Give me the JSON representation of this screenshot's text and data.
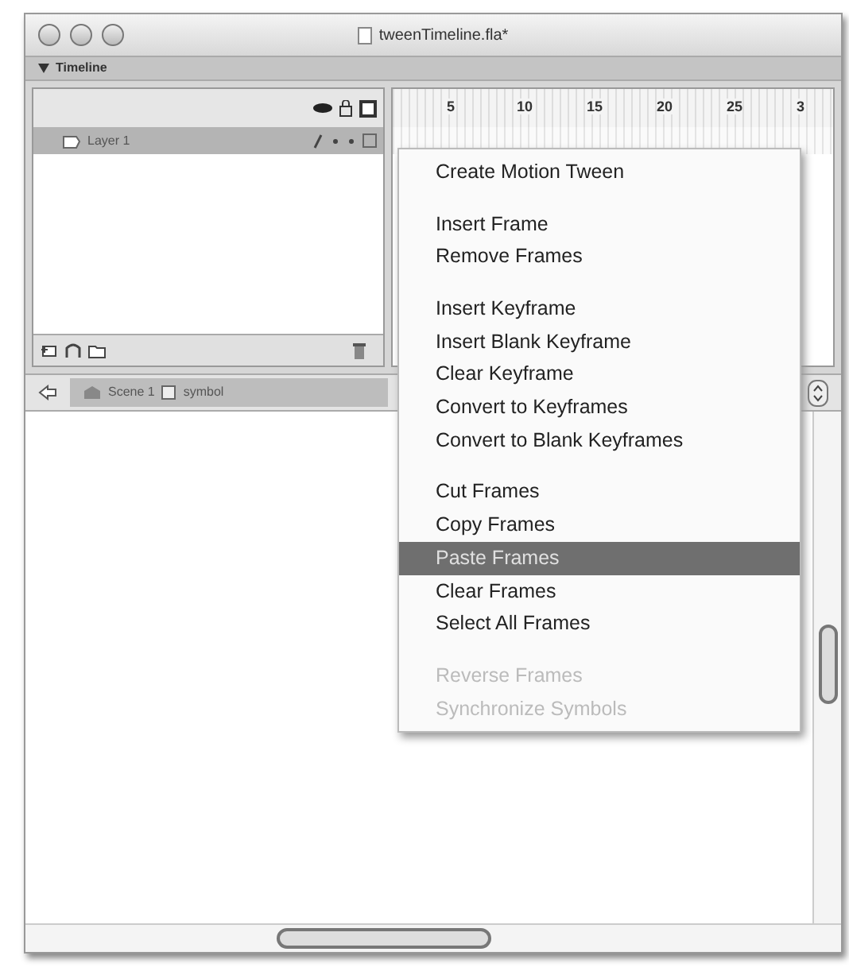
{
  "window": {
    "title": "tweenTimeline.fla*"
  },
  "timeline": {
    "header": "Timeline",
    "frame_numbers": [
      "5",
      "10",
      "15",
      "20",
      "25",
      "3"
    ],
    "layers": [
      {
        "name": "Layer 1",
        "selected": true
      }
    ]
  },
  "edit_bar": {
    "scene": "Scene 1",
    "symbol": "symbol"
  },
  "context_menu": [
    {
      "kind": "item",
      "label": "Create Motion Tween",
      "selected": false,
      "disabled": false
    },
    {
      "kind": "separator"
    },
    {
      "kind": "item",
      "label": "Insert Frame",
      "selected": false,
      "disabled": false
    },
    {
      "kind": "item",
      "label": "Remove Frames",
      "selected": false,
      "disabled": false
    },
    {
      "kind": "separator"
    },
    {
      "kind": "item",
      "label": "Insert Keyframe",
      "selected": false,
      "disabled": false
    },
    {
      "kind": "item",
      "label": "Insert Blank Keyframe",
      "selected": false,
      "disabled": false
    },
    {
      "kind": "item",
      "label": "Clear Keyframe",
      "selected": false,
      "disabled": false
    },
    {
      "kind": "item",
      "label": "Convert to Keyframes",
      "selected": false,
      "disabled": false
    },
    {
      "kind": "item",
      "label": "Convert to Blank Keyframes",
      "selected": false,
      "disabled": false
    },
    {
      "kind": "separator"
    },
    {
      "kind": "item",
      "label": "Cut Frames",
      "selected": false,
      "disabled": false
    },
    {
      "kind": "item",
      "label": "Copy Frames",
      "selected": false,
      "disabled": false
    },
    {
      "kind": "item",
      "label": "Paste Frames",
      "selected": true,
      "disabled": false
    },
    {
      "kind": "item",
      "label": "Clear Frames",
      "selected": false,
      "disabled": false
    },
    {
      "kind": "item",
      "label": "Select All Frames",
      "selected": false,
      "disabled": false
    },
    {
      "kind": "separator"
    },
    {
      "kind": "item",
      "label": "Reverse Frames",
      "selected": false,
      "disabled": true
    },
    {
      "kind": "item",
      "label": "Synchronize Symbols",
      "selected": false,
      "disabled": true
    }
  ]
}
